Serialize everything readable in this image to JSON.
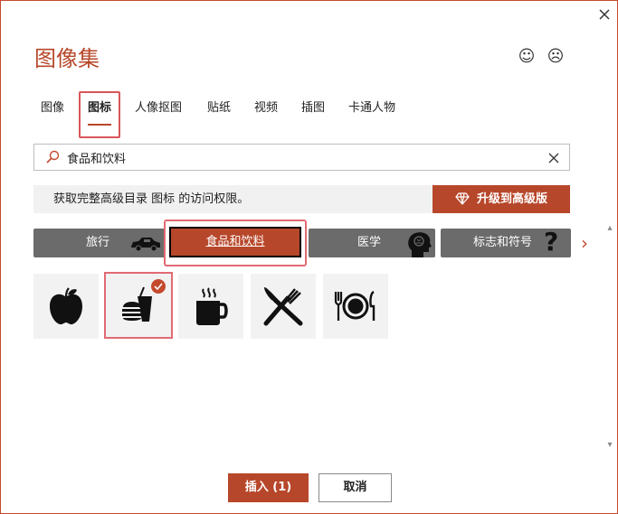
{
  "dialog": {
    "title": "图像集",
    "tabs": [
      {
        "label": "图像"
      },
      {
        "label": "图标"
      },
      {
        "label": "人像抠图"
      },
      {
        "label": "贴纸"
      },
      {
        "label": "视频"
      },
      {
        "label": "插图"
      },
      {
        "label": "卡通人物"
      }
    ],
    "active_tab": "图标",
    "search": {
      "value": "食品和饮料",
      "placeholder": ""
    },
    "promo": {
      "text": "获取完整高级目录 图标 的访问权限。",
      "upgrade_label": "升级到高级版"
    },
    "categories": [
      {
        "label": "旅行"
      },
      {
        "label": "食品和饮料"
      },
      {
        "label": "医学"
      },
      {
        "label": "标志和符号"
      }
    ],
    "active_category": "食品和饮料",
    "icons": [
      {
        "name": "apple-icon",
        "selected": false
      },
      {
        "name": "fast-food-icon",
        "selected": true
      },
      {
        "name": "coffee-cup-icon",
        "selected": false
      },
      {
        "name": "fork-knife-icon",
        "selected": false
      },
      {
        "name": "place-setting-icon",
        "selected": false
      }
    ],
    "buttons": {
      "insert_label": "插入 (1)",
      "cancel_label": "取消"
    },
    "colors": {
      "accent": "#b7472a",
      "selection_border": "#e06a74",
      "category_bg": "#6b6b6b",
      "tile_bg": "#f2f2f2"
    }
  }
}
